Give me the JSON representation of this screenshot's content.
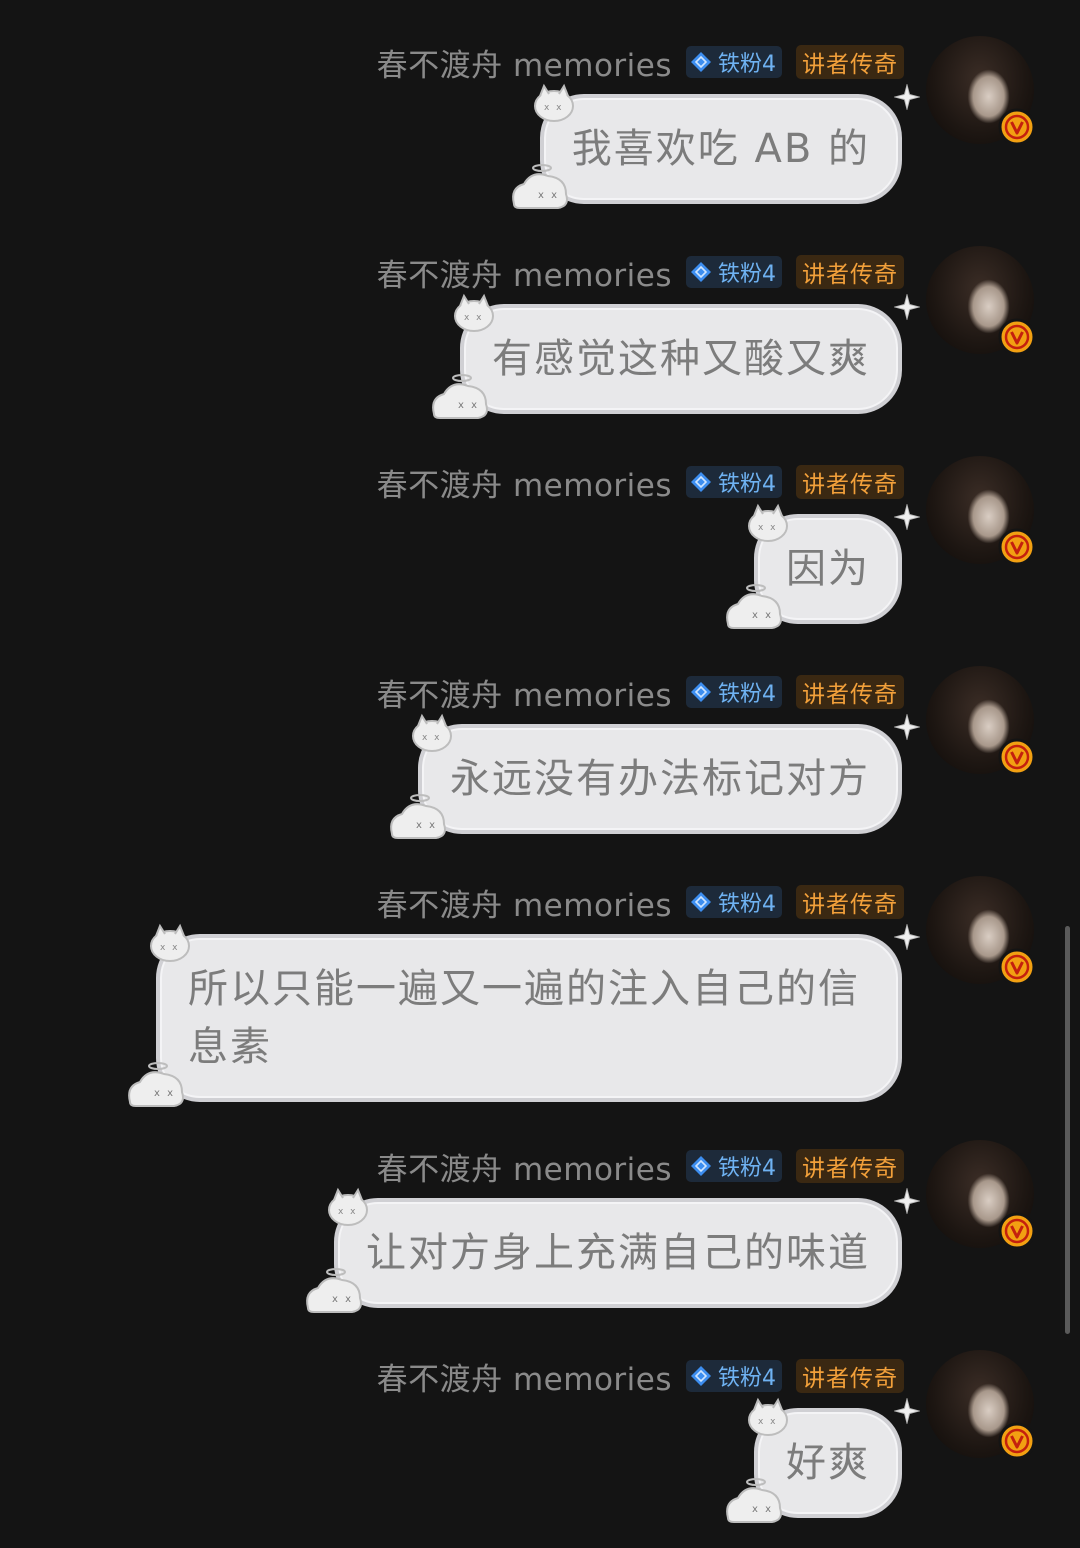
{
  "messages": [
    {
      "sender": "春不渡舟 memories",
      "fan_badge": "铁粉4",
      "level_badge": "讲者传奇",
      "text": "我喜欢吃 AB 的"
    },
    {
      "sender": "春不渡舟 memories",
      "fan_badge": "铁粉4",
      "level_badge": "讲者传奇",
      "text": "有感觉这种又酸又爽"
    },
    {
      "sender": "春不渡舟 memories",
      "fan_badge": "铁粉4",
      "level_badge": "讲者传奇",
      "text": "因为"
    },
    {
      "sender": "春不渡舟 memories",
      "fan_badge": "铁粉4",
      "level_badge": "讲者传奇",
      "text": "永远没有办法标记对方"
    },
    {
      "sender": "春不渡舟 memories",
      "fan_badge": "铁粉4",
      "level_badge": "讲者传奇",
      "text": "所以只能一遍又一遍的注入自己的信息素"
    },
    {
      "sender": "春不渡舟 memories",
      "fan_badge": "铁粉4",
      "level_badge": "讲者传奇",
      "text": "让对方身上充满自己的味道"
    },
    {
      "sender": "春不渡舟 memories",
      "fan_badge": "铁粉4",
      "level_badge": "讲者传奇",
      "text": "好爽"
    }
  ],
  "icons": {
    "fan_badge_icon": "diamond-icon",
    "verified_icon": "v-verified-icon",
    "bubble_decorations": [
      "cat-blob-icon",
      "sparkle-icon"
    ]
  },
  "colors": {
    "background": "#141414",
    "bubble": "#e8e8ea",
    "bubble_text": "#7c7c7c",
    "sender_name": "#8a8a8a",
    "fan_badge_text": "#6fb2f2",
    "level_badge_text": "#f2a03a",
    "verified_badge": "#f2a012"
  }
}
